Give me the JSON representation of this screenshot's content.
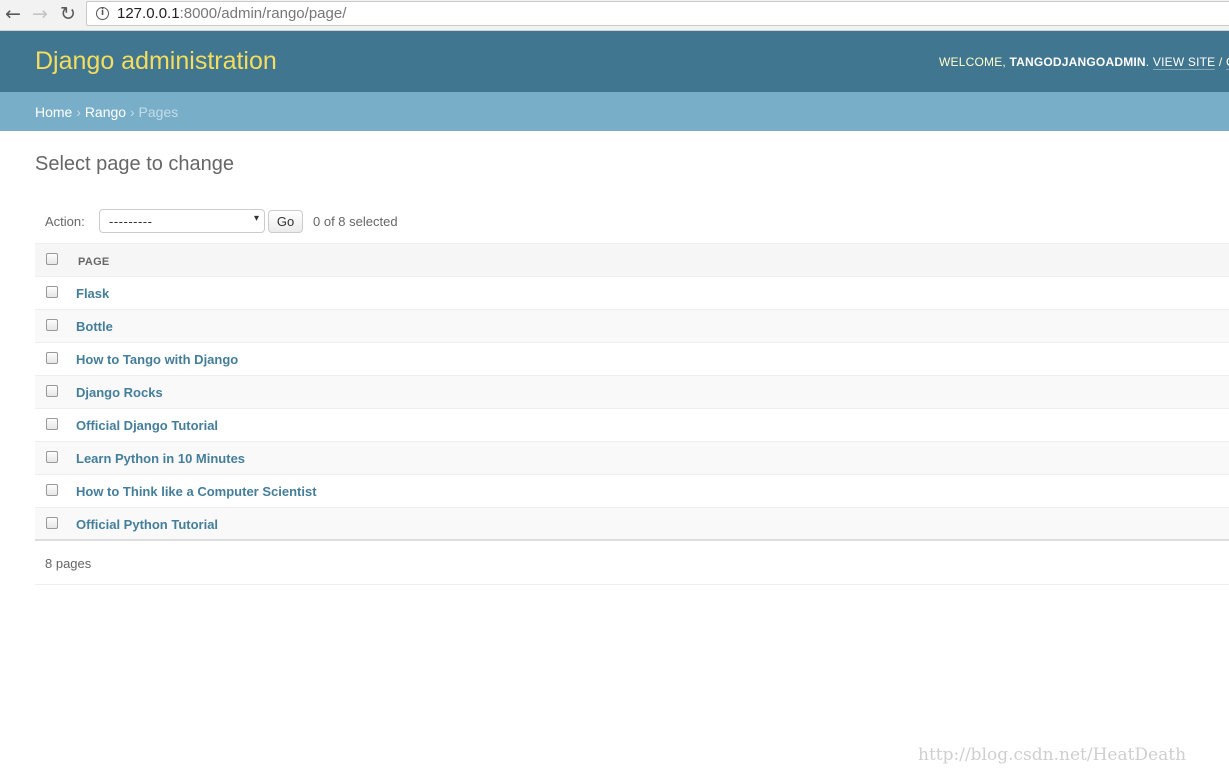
{
  "browser": {
    "url_host": "127.0.0.1",
    "url_path": ":8000/admin/rango/page/",
    "back_glyph": "←",
    "forward_glyph": "→",
    "reload_glyph": "↻",
    "info_glyph": "i"
  },
  "header": {
    "branding": "Django administration",
    "welcome": "WELCOME, ",
    "username": "TANGODJANGOADMIN",
    "after_user": ". ",
    "view_site": "VIEW SITE",
    "separator": " / ",
    "change_password_partial": "CH"
  },
  "breadcrumbs": {
    "home": "Home",
    "sep": " › ",
    "app": "Rango",
    "current": "Pages"
  },
  "content": {
    "title": "Select page to change"
  },
  "actions": {
    "label": "Action:",
    "select_value": "---------",
    "select_arrow": "▾",
    "go_label": "Go",
    "selected_count": "0 of 8 selected"
  },
  "table": {
    "column_header": "PAGE",
    "rows": [
      "Flask",
      "Bottle",
      "How to Tango with Django",
      "Django Rocks",
      "Official Django Tutorial",
      "Learn Python in 10 Minutes",
      "How to Think like a Computer Scientist",
      "Official Python Tutorial"
    ]
  },
  "paginator": {
    "text": "8 pages"
  },
  "watermark": "http://blog.csdn.net/HeatDeath",
  "colors": {
    "header_bg": "#417690",
    "branding": "#f5dd5d",
    "breadcrumb_bg": "#79aec8",
    "link": "#447e9b"
  }
}
